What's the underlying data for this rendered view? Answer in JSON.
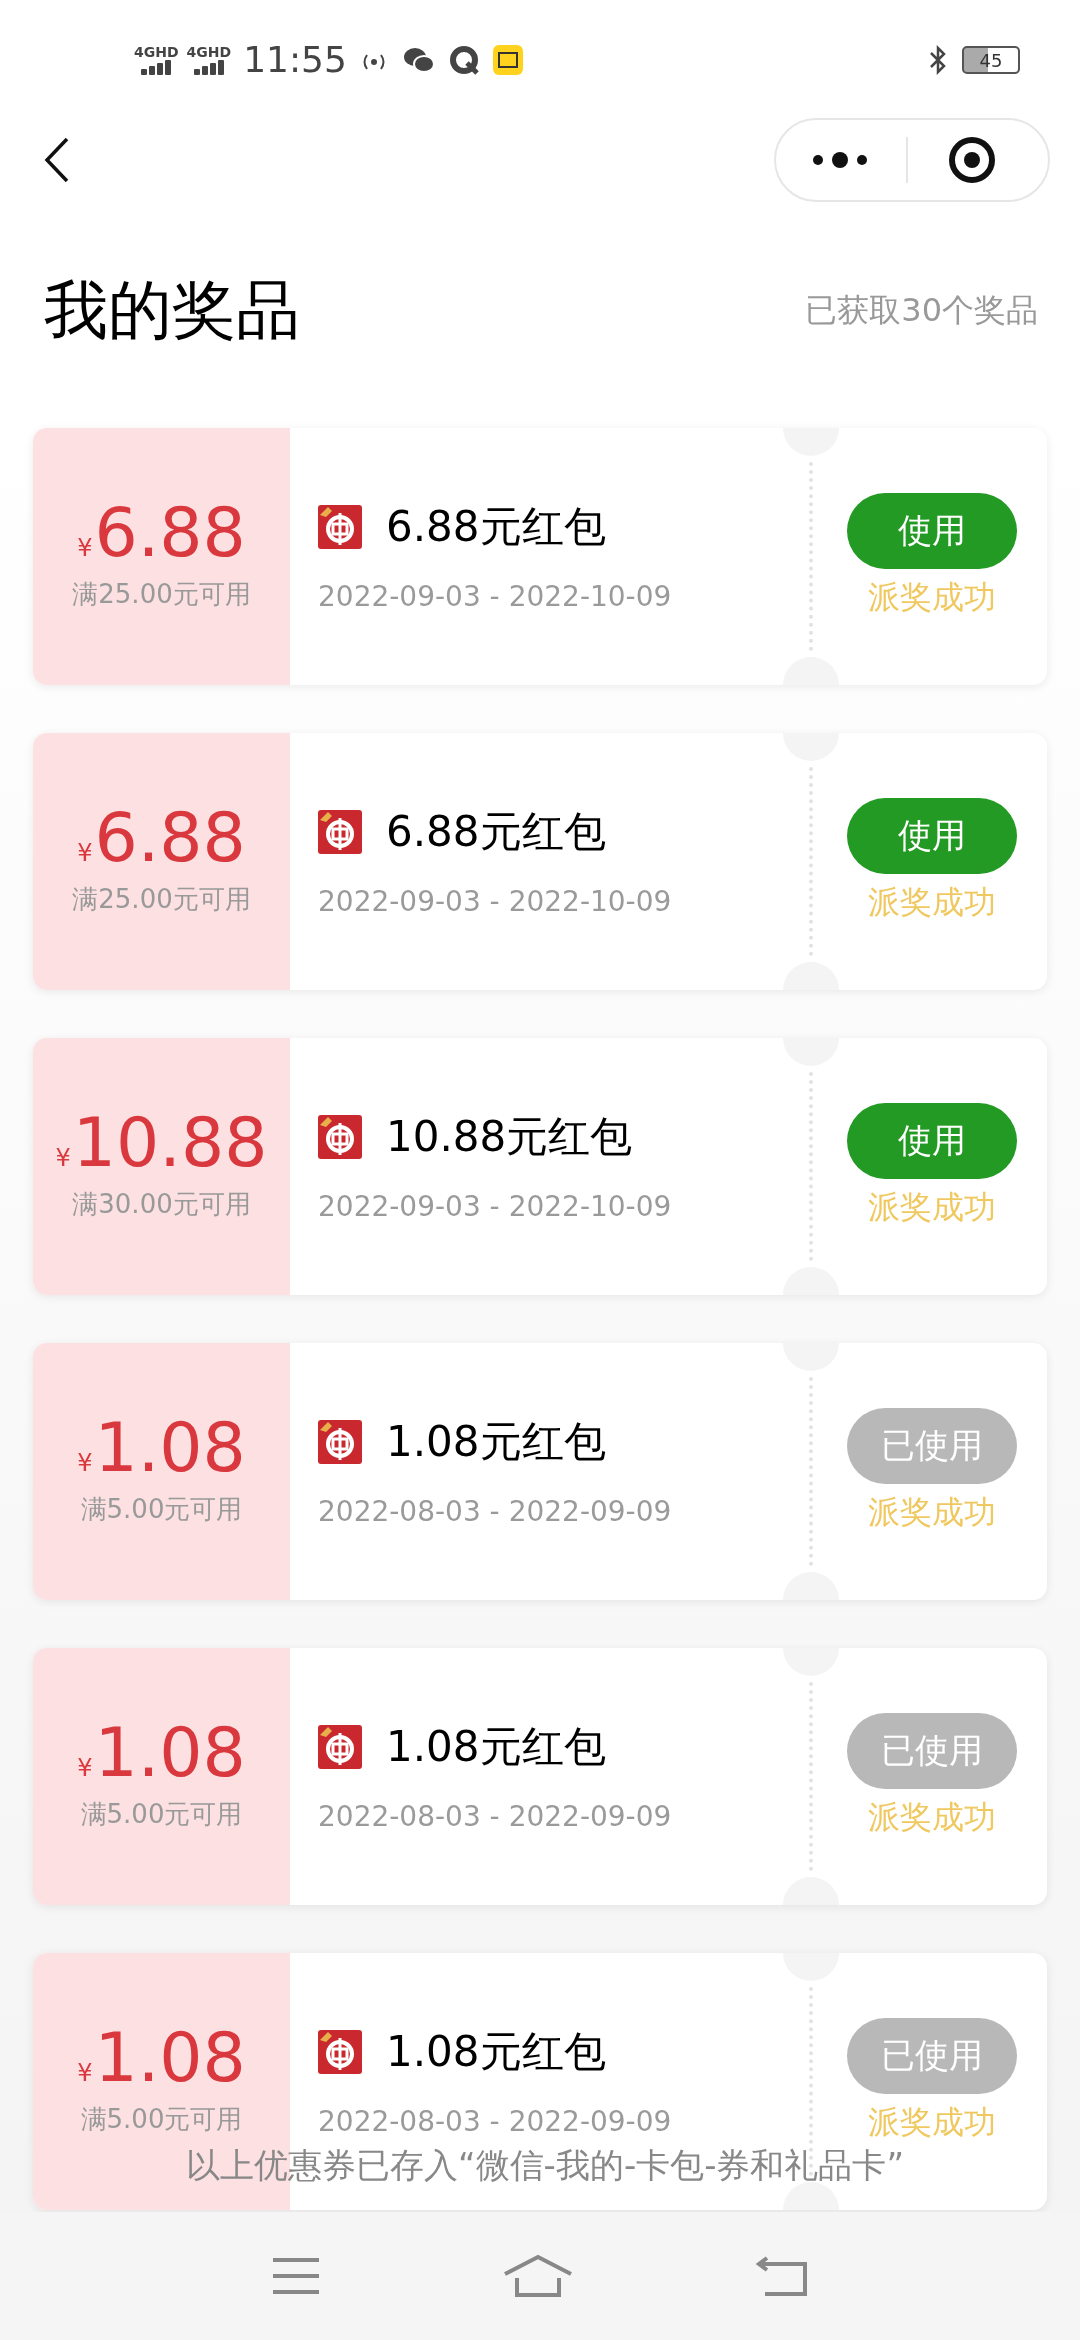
{
  "status_bar": {
    "network_1": "4GHD",
    "network_2": "4GHD",
    "time": "11:55",
    "battery": "45"
  },
  "header": {
    "title": "我的奖品",
    "count": "已获取30个奖品"
  },
  "prizes": [
    {
      "currency": "¥",
      "amount": "6.88",
      "condition": "满25.00元可用",
      "name": "6.88元红包",
      "period": "2022-09-03 - 2022-10-09",
      "button": "使用",
      "used": false,
      "status": "派奖成功"
    },
    {
      "currency": "¥",
      "amount": "6.88",
      "condition": "满25.00元可用",
      "name": "6.88元红包",
      "period": "2022-09-03 - 2022-10-09",
      "button": "使用",
      "used": false,
      "status": "派奖成功"
    },
    {
      "currency": "¥",
      "amount": "10.88",
      "condition": "满30.00元可用",
      "name": "10.88元红包",
      "period": "2022-09-03 - 2022-10-09",
      "button": "使用",
      "used": false,
      "status": "派奖成功"
    },
    {
      "currency": "¥",
      "amount": "1.08",
      "condition": "满5.00元可用",
      "name": "1.08元红包",
      "period": "2022-08-03 - 2022-09-09",
      "button": "已使用",
      "used": true,
      "status": "派奖成功"
    },
    {
      "currency": "¥",
      "amount": "1.08",
      "condition": "满5.00元可用",
      "name": "1.08元红包",
      "period": "2022-08-03 - 2022-09-09",
      "button": "已使用",
      "used": true,
      "status": "派奖成功"
    },
    {
      "currency": "¥",
      "amount": "1.08",
      "condition": "满5.00元可用",
      "name": "1.08元红包",
      "period": "2022-08-03 - 2022-09-09",
      "button": "已使用",
      "used": true,
      "status": "派奖成功"
    }
  ],
  "toast": "以上优惠券已存入“微信-我的-卡包-券和礼品卡”"
}
